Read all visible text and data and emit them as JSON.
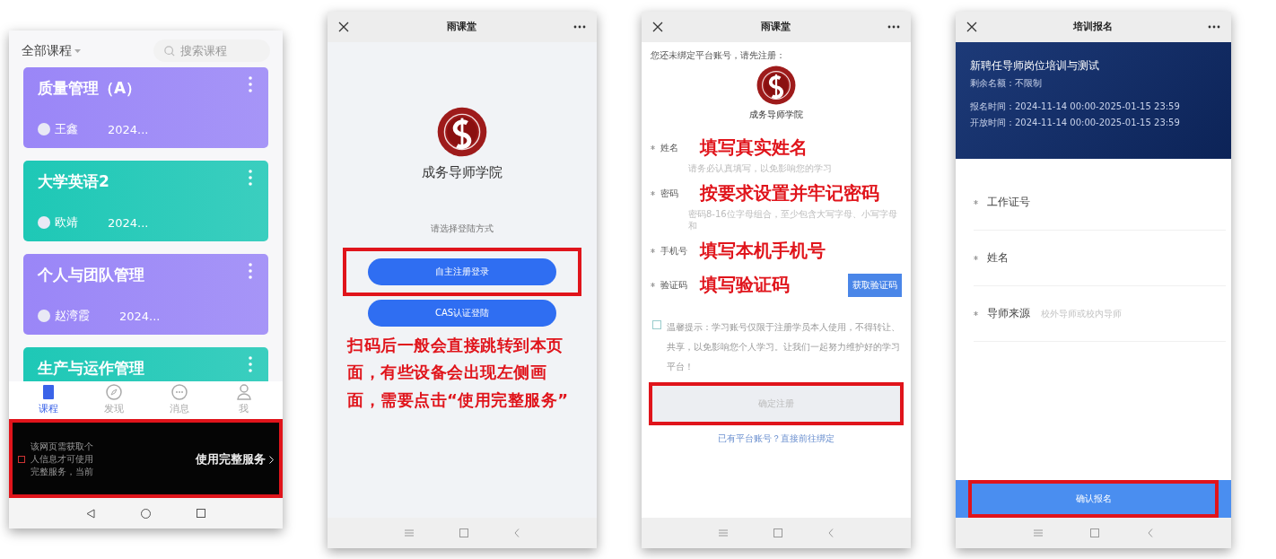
{
  "course_app": {
    "filter": "全部课程",
    "search": {
      "placeholder": "搜索课程"
    },
    "courses": [
      {
        "title": "质量管理（A）",
        "teacher": "王鑫",
        "date": "2024...",
        "color": "#9a86f7"
      },
      {
        "title": "大学英语2",
        "teacher": "欧靖",
        "date": "2024...",
        "color": "#1ec8b6"
      },
      {
        "title": "个人与团队管理",
        "teacher": "赵湾霞",
        "date": "2024...",
        "color": "#9a86f7"
      },
      {
        "title": "生产与运作管理",
        "color": "#1ec8b6"
      }
    ],
    "tabs": [
      {
        "label": "课程",
        "selected": true
      },
      {
        "label": "发现",
        "selected": false
      },
      {
        "label": "消息",
        "selected": false
      },
      {
        "label": "我",
        "selected": false
      }
    ],
    "banner": {
      "text": "该网页需获取个人信息才可使用完整服务，当前",
      "action": "使用完整服务",
      "highlighted": true
    }
  },
  "login_page": {
    "title": "雨课堂",
    "school": "成务导师学院",
    "prompt": "请选择登陆方式",
    "buttons": [
      {
        "label": "自主注册登录",
        "highlighted": true
      },
      {
        "label": "CAS认证登陆",
        "highlighted": false
      }
    ],
    "note": "扫码后一般会直接跳转到本页面，有些设备会出现左侧画面，需要点击“使用完整服务”"
  },
  "register_page": {
    "title": "雨课堂",
    "intro": "您还未绑定平台账号，请先注册：",
    "school": "成务导师学院",
    "fields": [
      {
        "label": "姓名",
        "required": true,
        "note": "填写真实姓名",
        "hint": "请务必认真填写，以免影响您的学习"
      },
      {
        "label": "密码",
        "required": true,
        "note": "按要求设置并牢记密码",
        "hint": "密码8-16位字母组合，至少包含大写字母、小写字母和"
      },
      {
        "label": "手机号",
        "required": true,
        "note": "填写本机手机号"
      },
      {
        "label": "验证码",
        "required": true,
        "note": "填写验证码",
        "button": "获取验证码"
      }
    ],
    "agreement": {
      "text": "温馨提示：学习账号仅限于注册学员本人使用，不得转让、共享，以免影响您个人学习。让我们一起努力维护好的学习平台！",
      "checked": false
    },
    "submit": {
      "label": "确定注册",
      "highlighted": true
    },
    "link": "已有平台账号？直接前往绑定"
  },
  "signup_page": {
    "title": "培训报名",
    "course": "新聘任导师岗位培训与测试",
    "quota": "剩余名额：不限制",
    "times": [
      "报名时间：2024-11-14 00:00-2025-01-15 23:59",
      "开放时间：2024-11-14 00:00-2025-01-15 23:59"
    ],
    "fields": [
      {
        "label": "工作证号",
        "required": true
      },
      {
        "label": "姓名",
        "required": true
      },
      {
        "label": "导师来源",
        "required": true,
        "placeholder": "校外导师或校内导师"
      }
    ],
    "submit": {
      "label": "确认报名",
      "highlighted": true
    }
  }
}
